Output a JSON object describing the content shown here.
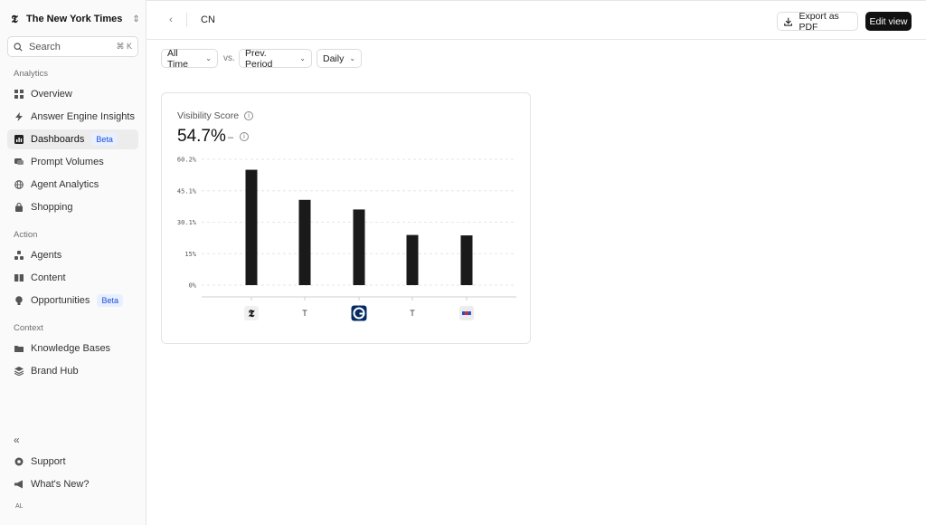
{
  "app": {
    "brand_name": "The New York Times",
    "brand_logo": "𝕿",
    "search_placeholder": "Search",
    "search_shortcut": "⌘ K"
  },
  "sidebar": {
    "sections": {
      "analytics": "Analytics",
      "action": "Action",
      "context": "Context"
    },
    "analytics_items": [
      {
        "label": "Overview",
        "icon": "grid-icon"
      },
      {
        "label": "Answer Engine Insights",
        "icon": "bolt-icon"
      },
      {
        "label": "Dashboards",
        "icon": "chart-icon",
        "badge": "Beta",
        "active": true
      },
      {
        "label": "Prompt Volumes",
        "icon": "chat-icon"
      },
      {
        "label": "Agent Analytics",
        "icon": "globe-icon"
      },
      {
        "label": "Shopping",
        "icon": "bag-icon"
      }
    ],
    "action_items": [
      {
        "label": "Agents",
        "icon": "agents-icon"
      },
      {
        "label": "Content",
        "icon": "book-icon"
      },
      {
        "label": "Opportunities",
        "icon": "bulb-icon",
        "badge": "Beta"
      }
    ],
    "context_items": [
      {
        "label": "Knowledge Bases",
        "icon": "folder-icon"
      },
      {
        "label": "Brand Hub",
        "icon": "layers-icon"
      }
    ],
    "footer_items": [
      {
        "label": "Support",
        "icon": "support-icon"
      },
      {
        "label": "What's New?",
        "icon": "megaphone-icon"
      }
    ],
    "collapse_glyph": "«",
    "avatar_initials": "AL"
  },
  "header": {
    "title": "CN",
    "back_glyph": "‹",
    "export_label": "Export as PDF",
    "edit_label": "Edit view"
  },
  "filters": {
    "range": "All Time",
    "vs_label": "vs.",
    "comparison": "Prev. Period",
    "granularity": "Daily"
  },
  "card": {
    "title": "Visibility Score",
    "value": "54.7%",
    "delta": "–"
  },
  "colors": {
    "bar": "#1a1a1a",
    "accent_badge": "#1d4ed8"
  },
  "chart_data": {
    "type": "bar",
    "categories": [
      "nyt-logo",
      "T",
      "guardian-logo",
      "T",
      "flag-logo"
    ],
    "category_labels": [
      "",
      "T",
      "",
      "T",
      ""
    ],
    "values": [
      55.2,
      40.8,
      36.2,
      24.0,
      23.8
    ],
    "y_ticks": [
      "0%",
      "15%",
      "30.1%",
      "45.1%",
      "60.2%"
    ],
    "ylim": [
      0,
      60.2
    ],
    "grid": true
  }
}
